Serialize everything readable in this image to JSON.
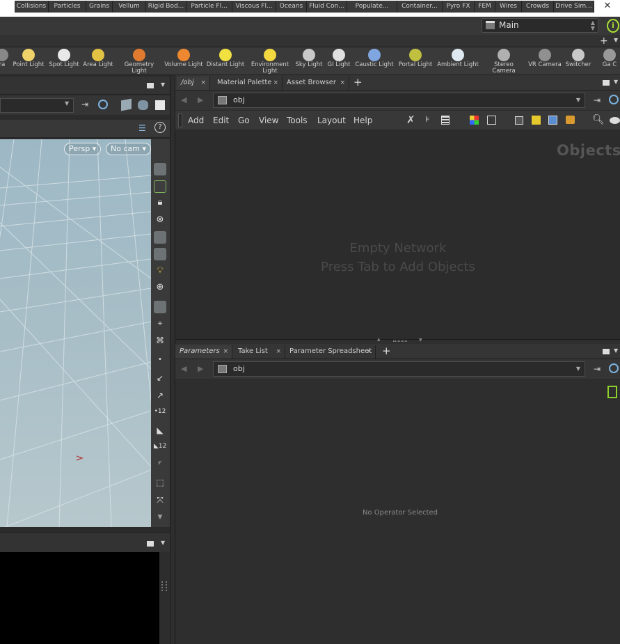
{
  "window": {
    "minimize_glyph": "—",
    "maximize_glyph": "☐",
    "close_glyph": "✕"
  },
  "desktop": {
    "name": "Main"
  },
  "shelf_tabs": [
    "Collisions",
    "Particles",
    "Grains",
    "Vellum",
    "Rigid Bod...",
    "Particle Fl...",
    "Viscous Fl...",
    "Oceans",
    "Fluid Con...",
    "Populate...",
    "Container...",
    "Pyro FX",
    "FEM",
    "Wires",
    "Crowds",
    "Drive Sim..."
  ],
  "shelf_tools": [
    {
      "label": "ra",
      "icon": "camera-icon"
    },
    {
      "label": "Point Light",
      "icon": "point-light-icon"
    },
    {
      "label": "Spot Light",
      "icon": "spot-light-icon"
    },
    {
      "label": "Area Light",
      "icon": "area-light-icon"
    },
    {
      "label": "Geometry Light",
      "icon": "geometry-light-icon"
    },
    {
      "label": "Volume Light",
      "icon": "volume-light-icon"
    },
    {
      "label": "Distant Light",
      "icon": "distant-light-icon"
    },
    {
      "label": "Environment Light",
      "icon": "environment-light-icon"
    },
    {
      "label": "Sky Light",
      "icon": "sky-light-icon"
    },
    {
      "label": "GI Light",
      "icon": "gi-light-icon"
    },
    {
      "label": "Caustic Light",
      "icon": "caustic-light-icon"
    },
    {
      "label": "Portal Light",
      "icon": "portal-light-icon"
    },
    {
      "label": "Ambient Light",
      "icon": "ambient-light-icon"
    },
    {
      "label": "Stereo Camera",
      "icon": "stereo-camera-icon"
    },
    {
      "label": "VR Camera",
      "icon": "vr-camera-icon"
    },
    {
      "label": "Switcher",
      "icon": "switcher-icon"
    },
    {
      "label": "Ga C",
      "icon": "gamepad-camera-icon"
    }
  ],
  "viewport": {
    "view_label": "Persp ▾",
    "camera_label": "No cam ▾"
  },
  "network_pane": {
    "tabs": [
      {
        "label": "/obj",
        "active": true
      },
      {
        "label": "Material Palette",
        "active": false
      },
      {
        "label": "Asset Browser",
        "active": false
      }
    ],
    "path": "obj",
    "menus": [
      "Add",
      "Edit",
      "Go",
      "View",
      "Tools",
      "Layout",
      "Help"
    ],
    "context_title": "Objects",
    "empty_line1": "Empty Network",
    "empty_line2": "Press Tab to Add Objects"
  },
  "params_pane": {
    "tabs": [
      {
        "label": "Parameters",
        "active": true
      },
      {
        "label": "Take List",
        "active": false
      },
      {
        "label": "Parameter Spreadsheet",
        "active": false
      }
    ],
    "path": "obj",
    "empty_text": "No Operator Selected"
  },
  "colors": {
    "accent_green": "#a8e033",
    "panel": "#2c2c2c",
    "viewport_sky": "#9db8c5"
  }
}
